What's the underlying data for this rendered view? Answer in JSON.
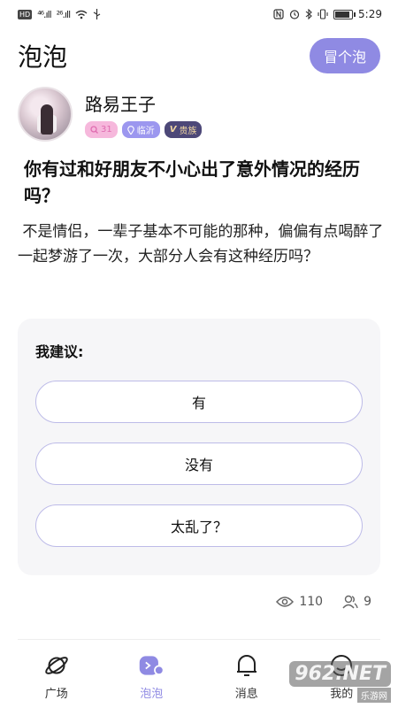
{
  "status_bar": {
    "hd": "HD",
    "signal1": "⁴⁶.ıll",
    "signal2": "²⁶.ıll",
    "time": "5:29"
  },
  "header": {
    "title": "泡泡",
    "post_button": "冒个泡"
  },
  "author": {
    "name": "路易王子",
    "level": "31",
    "city": "临沂",
    "vip": "贵族"
  },
  "post": {
    "question": "你有过和好朋友不小心出了意外情况的经历吗？",
    "description": "不是情侣，一辈子基本不可能的那种，偏偏有点喝醉了一起梦游了一次，大部分人会有这种经历吗？"
  },
  "poll": {
    "title": "我建议:",
    "options": [
      "有",
      "没有",
      "太乱了？"
    ]
  },
  "stats": {
    "views": "110",
    "participants": "9"
  },
  "tabs": [
    {
      "label": "广场",
      "icon": "planet-icon"
    },
    {
      "label": "泡泡",
      "icon": "bubble-icon"
    },
    {
      "label": "消息",
      "icon": "bell-icon"
    },
    {
      "label": "我的",
      "icon": "profile-icon"
    }
  ],
  "watermark": {
    "big": "962.NET",
    "small": "乐游网"
  },
  "colors": {
    "accent": "#8f8ae3",
    "card_bg": "#f6f6f8",
    "option_border": "#bdbbe8"
  }
}
